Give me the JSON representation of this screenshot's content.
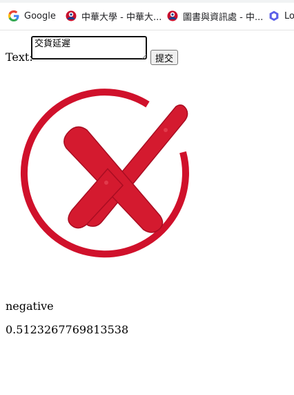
{
  "bookmarks": [
    {
      "label": "Google",
      "icon": "google-g-icon"
    },
    {
      "label": "中華大學 - 中華大...",
      "icon": "chu-logo-icon"
    },
    {
      "label": "圖書與資訊處 - 中...",
      "icon": "chu-logo-icon"
    },
    {
      "label": "Lo",
      "icon": "hexagon-app-icon"
    }
  ],
  "form": {
    "text_label": "Text:",
    "input_value": "交貨延遲",
    "submit_label": "提交"
  },
  "result": {
    "image_icon": "red-cross-circle-icon",
    "sentiment": "negative",
    "score": "0.5123267769813538"
  },
  "colors": {
    "cross_red": "#d0112b",
    "bookmark_text": "#202124",
    "bar_border": "#e3e3e3"
  }
}
